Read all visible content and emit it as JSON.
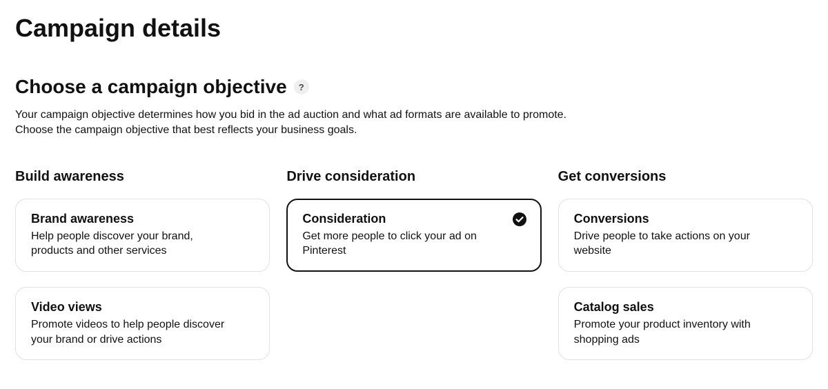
{
  "page_title": "Campaign details",
  "section": {
    "title": "Choose a campaign objective",
    "help_glyph": "?",
    "description_line1": "Your campaign objective determines how you bid in the ad auction and what ad formats are available to promote.",
    "description_line2": "Choose the campaign objective that best reflects your business goals."
  },
  "columns": {
    "awareness": {
      "title": "Build awareness",
      "cards": [
        {
          "title": "Brand awareness",
          "desc": "Help people discover your brand, products and other services",
          "selected": false
        },
        {
          "title": "Video views",
          "desc": "Promote videos to help people discover your brand or drive actions",
          "selected": false
        }
      ]
    },
    "consideration": {
      "title": "Drive consideration",
      "cards": [
        {
          "title": "Consideration",
          "desc": "Get more people to click your ad on Pinterest",
          "selected": true
        }
      ]
    },
    "conversions": {
      "title": "Get conversions",
      "cards": [
        {
          "title": "Conversions",
          "desc": "Drive people to take actions on your website",
          "selected": false
        },
        {
          "title": "Catalog sales",
          "desc": "Promote your product inventory with shopping ads",
          "selected": false
        }
      ]
    }
  }
}
